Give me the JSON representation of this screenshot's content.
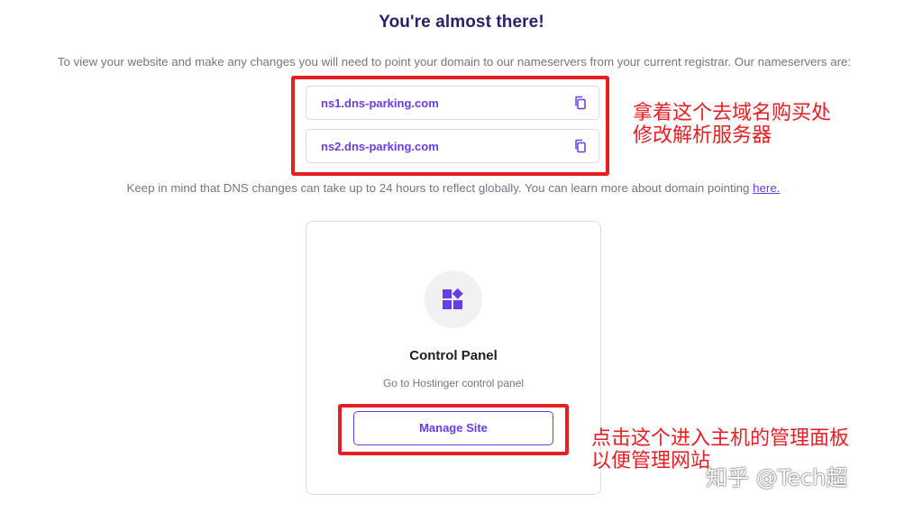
{
  "header": {
    "title": "You're almost there!",
    "subtitle": "To view your website and make any changes you will need to point your domain to our nameservers from your current registrar. Our nameservers are:"
  },
  "nameservers": [
    {
      "value": "ns1.dns-parking.com",
      "icon": "copy-icon"
    },
    {
      "value": "ns2.dns-parking.com",
      "icon": "copy-icon"
    }
  ],
  "note": {
    "text": "Keep in mind that DNS changes can take up to 24 hours to reflect globally. You can learn more about domain pointing ",
    "link": "here."
  },
  "card": {
    "icon": "apps-grid-icon",
    "title": "Control Panel",
    "description": "Go to Hostinger control panel",
    "button_label": "Manage Site"
  },
  "annotations": {
    "nameserver_note_line1": "拿着这个去域名购买处",
    "nameserver_note_line2": "修改解析服务器",
    "manage_note_line1": "点击这个进入主机的管理面板",
    "manage_note_line2": "以便管理网站"
  },
  "watermark": "知乎 @Tech超",
  "colors": {
    "accent": "#673de6",
    "title": "#2f1c6a",
    "annotation_red": "#e61e24"
  }
}
